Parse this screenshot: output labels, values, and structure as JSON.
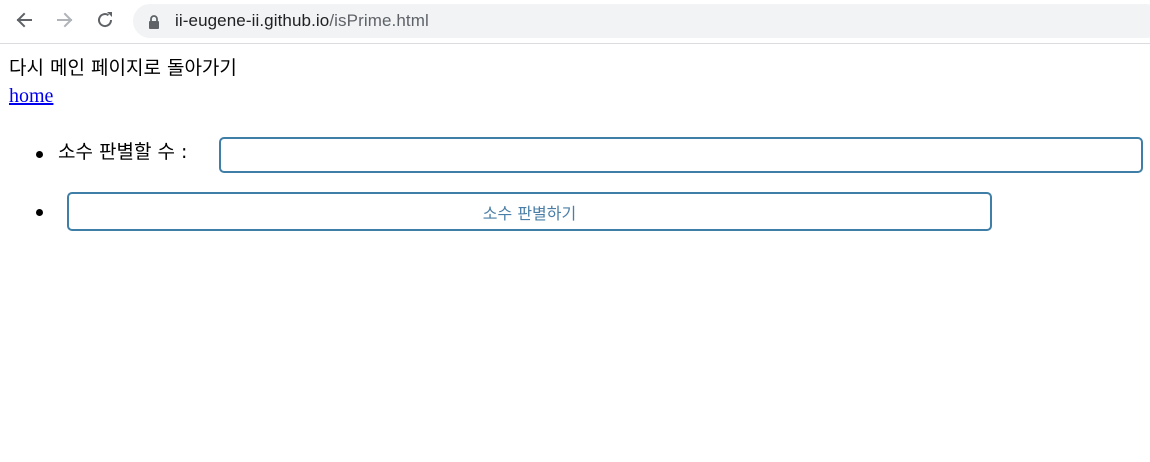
{
  "browser": {
    "url_host": "ii-eugene-ii.github.io",
    "url_path": "/isPrime.html",
    "icons": {
      "back": "arrow-left-icon",
      "forward": "arrow-right-icon",
      "reload": "reload-icon",
      "lock": "lock-icon"
    }
  },
  "page": {
    "back_text": "다시 메인 페이지로 돌아가기",
    "home_link": "home",
    "list": {
      "input_label": "소수 판별할 수 :",
      "input_value": "",
      "button_label": "소수 판별하기"
    }
  },
  "colors": {
    "accent_border": "#3f7ea6",
    "button_text": "#4a7ea6",
    "link": "#0000ee"
  }
}
